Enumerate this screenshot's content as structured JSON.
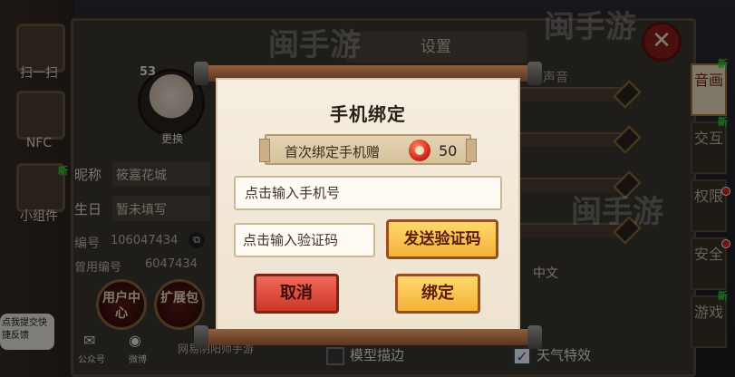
{
  "background": {
    "left_sidebar": [
      {
        "label": "扫一扫",
        "icon": "scan-icon"
      },
      {
        "label": "NFC",
        "icon": "nfc-icon"
      },
      {
        "label": "小组件",
        "icon": "widget-icon"
      }
    ],
    "settings_title": "设置",
    "sound_section_label": "声音",
    "profile": {
      "level": "53",
      "change_label": "更换",
      "nickname_label": "昵称",
      "nickname_value": "筱嘉花城",
      "birthday_label": "生日",
      "birthday_value": "暂未填写",
      "id_label": "编号",
      "id_value": "106047434",
      "former_id_label": "曾用编号",
      "former_id_value": "6047434"
    },
    "round_buttons": [
      {
        "label": "用户中心"
      },
      {
        "label": "扩展包"
      }
    ],
    "feedback_bubble": "点我提交快捷反馈",
    "social": [
      {
        "label": "公众号",
        "icon": "wechat-icon"
      },
      {
        "label": "微博",
        "icon": "weibo-icon"
      }
    ],
    "partner_text": "网易阴阳师手游",
    "language_value": "中文",
    "checkboxes": [
      {
        "label": "模型描边",
        "checked": false
      },
      {
        "label": "天气特效",
        "checked": true
      }
    ],
    "right_tabs": [
      {
        "label": "音画",
        "active": true
      },
      {
        "label": "交互",
        "active": false
      },
      {
        "label": "权限",
        "active": false
      },
      {
        "label": "安全",
        "active": false
      },
      {
        "label": "游戏",
        "active": false
      }
    ],
    "new_badge_text": "新",
    "close_symbol": "✕",
    "watermarks": [
      "闽手游",
      "闽手游",
      "闽手游"
    ]
  },
  "dialog": {
    "title": "手机绑定",
    "reward_text": "首次绑定手机赠",
    "reward_icon": "red-jade-icon",
    "reward_amount": "50",
    "phone_placeholder": "点击输入手机号",
    "code_placeholder": "点击输入验证码",
    "send_code_label": "发送验证码",
    "cancel_label": "取消",
    "bind_label": "绑定"
  },
  "colors": {
    "dialog_bg": "#f6eee0",
    "gold_button": "#f3b23a",
    "red_button": "#cc3726",
    "scroll_rod": "#8e5e3e"
  }
}
